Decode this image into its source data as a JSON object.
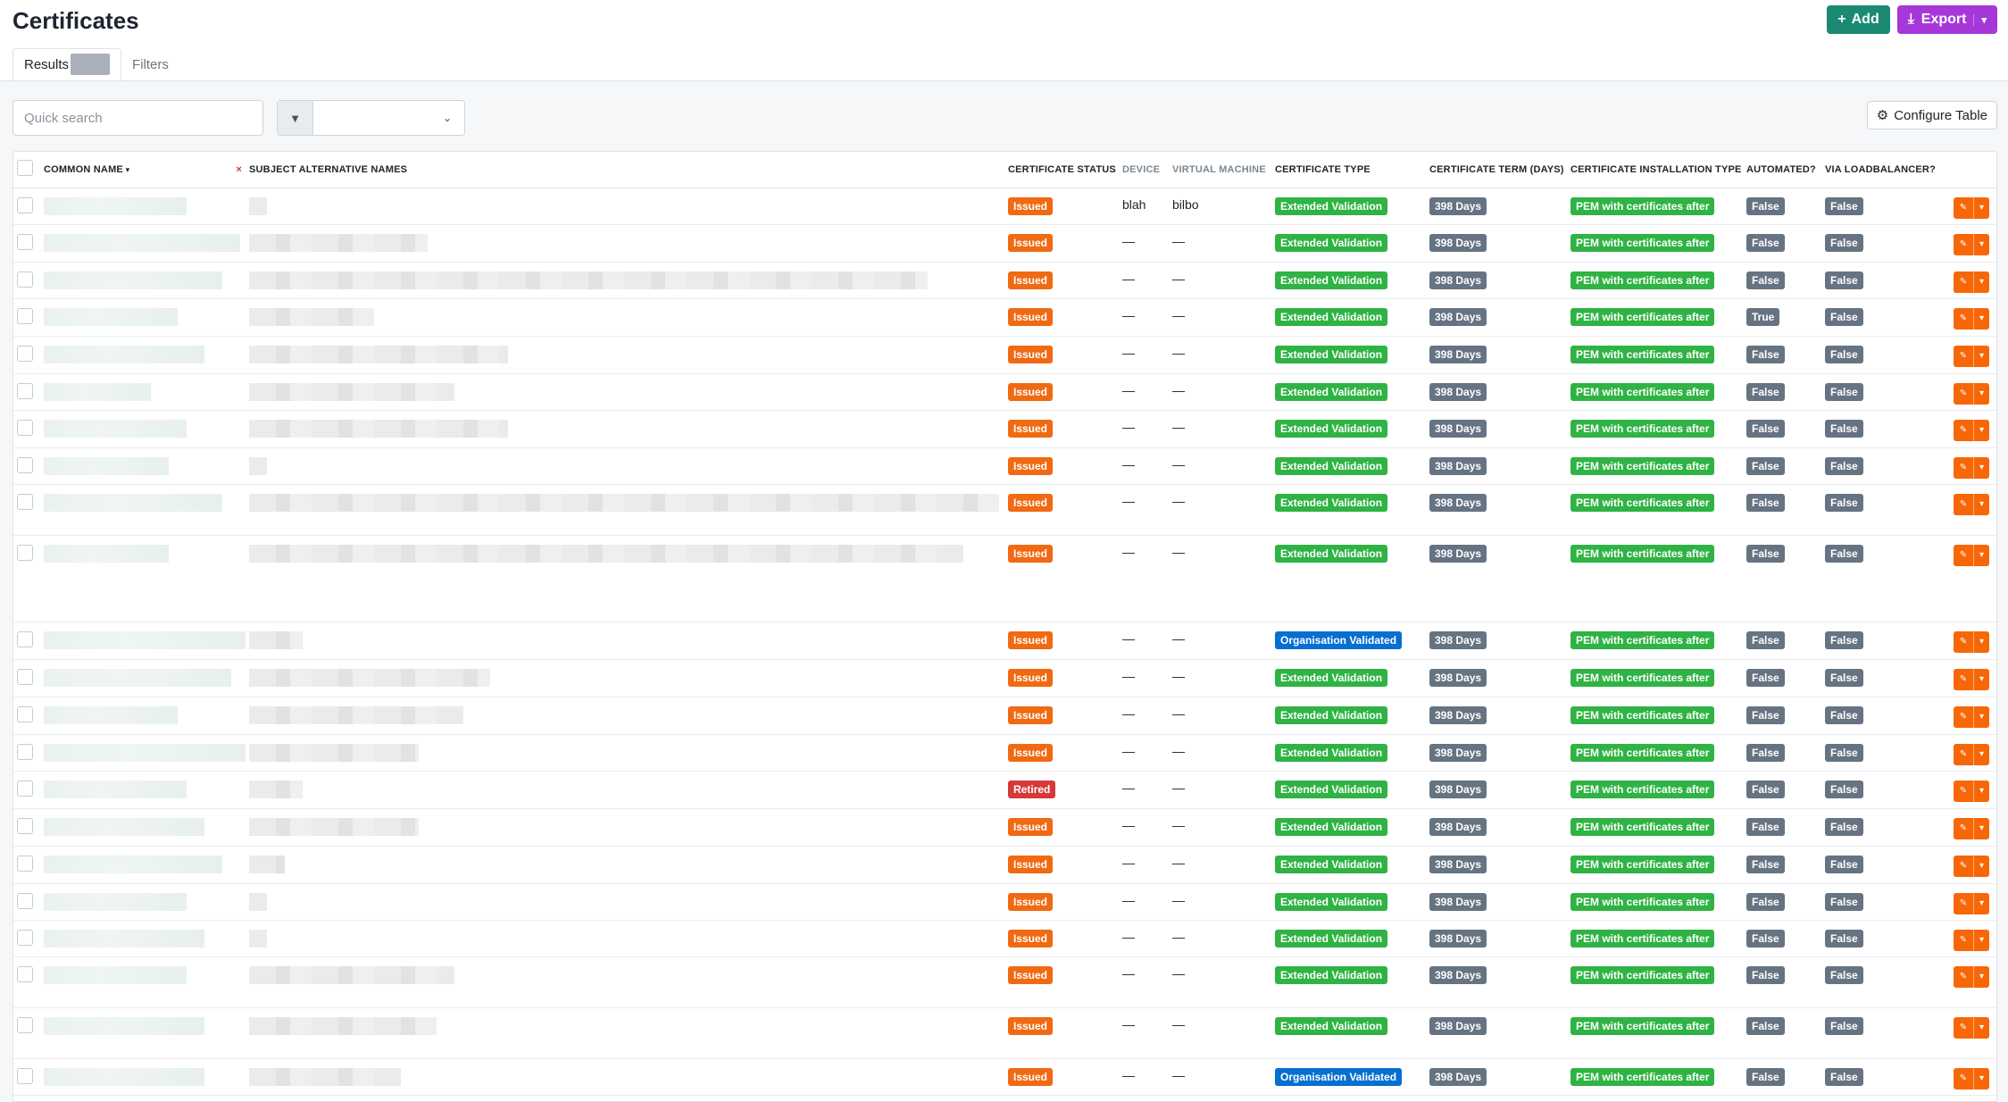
{
  "page": {
    "title": "Certificates"
  },
  "header": {
    "add_label": "Add",
    "export_label": "Export"
  },
  "tabs": [
    {
      "label": "Results"
    },
    {
      "label": "Filters"
    }
  ],
  "toolbar": {
    "search_placeholder": "Quick search",
    "configure_label": "Configure Table"
  },
  "columns": {
    "common_name": "Common Name",
    "san": "Subject Alternative Names",
    "status": "Certificate Status",
    "device": "Device",
    "vm": "Virtual Machine",
    "type": "Certificate Type",
    "term": "Certificate Term (Days)",
    "install": "Certificate Installation Type",
    "automated": "Automated?",
    "lb": "Via Loadbalancer?"
  },
  "colors": {
    "issued": "#f06a13",
    "retired": "#d63939",
    "green": "#2fb344",
    "blue": "#066fd1",
    "grey": "#667382",
    "add": "#1c8a73",
    "export": "#a737d9"
  },
  "rows": [
    {
      "status": "Issued",
      "device": "blah",
      "vm": "bilbo",
      "type": "Extended Validation",
      "term": "398 Days",
      "install": "PEM with certificates after",
      "automated": "False",
      "lb": "False"
    },
    {
      "status": "Issued",
      "device": "—",
      "vm": "—",
      "type": "Extended Validation",
      "term": "398 Days",
      "install": "PEM with certificates after",
      "automated": "False",
      "lb": "False"
    },
    {
      "status": "Issued",
      "device": "—",
      "vm": "—",
      "type": "Extended Validation",
      "term": "398 Days",
      "install": "PEM with certificates after",
      "automated": "False",
      "lb": "False"
    },
    {
      "status": "Issued",
      "device": "—",
      "vm": "—",
      "type": "Extended Validation",
      "term": "398 Days",
      "install": "PEM with certificates after",
      "automated": "True",
      "lb": "False"
    },
    {
      "status": "Issued",
      "device": "—",
      "vm": "—",
      "type": "Extended Validation",
      "term": "398 Days",
      "install": "PEM with certificates after",
      "automated": "False",
      "lb": "False"
    },
    {
      "status": "Issued",
      "device": "—",
      "vm": "—",
      "type": "Extended Validation",
      "term": "398 Days",
      "install": "PEM with certificates after",
      "automated": "False",
      "lb": "False"
    },
    {
      "status": "Issued",
      "device": "—",
      "vm": "—",
      "type": "Extended Validation",
      "term": "398 Days",
      "install": "PEM with certificates after",
      "automated": "False",
      "lb": "False"
    },
    {
      "status": "Issued",
      "device": "—",
      "vm": "—",
      "type": "Extended Validation",
      "term": "398 Days",
      "install": "PEM with certificates after",
      "automated": "False",
      "lb": "False"
    },
    {
      "status": "Issued",
      "device": "—",
      "vm": "—",
      "type": "Extended Validation",
      "term": "398 Days",
      "install": "PEM with certificates after",
      "automated": "False",
      "lb": "False"
    },
    {
      "status": "Issued",
      "device": "—",
      "vm": "—",
      "type": "Extended Validation",
      "term": "398 Days",
      "install": "PEM with certificates after",
      "automated": "False",
      "lb": "False"
    },
    {
      "status": "Issued",
      "device": "—",
      "vm": "—",
      "type": "Organisation Validated",
      "term": "398 Days",
      "install": "PEM with certificates after",
      "automated": "False",
      "lb": "False"
    },
    {
      "status": "Issued",
      "device": "—",
      "vm": "—",
      "type": "Extended Validation",
      "term": "398 Days",
      "install": "PEM with certificates after",
      "automated": "False",
      "lb": "False"
    },
    {
      "status": "Issued",
      "device": "—",
      "vm": "—",
      "type": "Extended Validation",
      "term": "398 Days",
      "install": "PEM with certificates after",
      "automated": "False",
      "lb": "False"
    },
    {
      "status": "Issued",
      "device": "—",
      "vm": "—",
      "type": "Extended Validation",
      "term": "398 Days",
      "install": "PEM with certificates after",
      "automated": "False",
      "lb": "False"
    },
    {
      "status": "Retired",
      "device": "—",
      "vm": "—",
      "type": "Extended Validation",
      "term": "398 Days",
      "install": "PEM with certificates after",
      "automated": "False",
      "lb": "False"
    },
    {
      "status": "Issued",
      "device": "—",
      "vm": "—",
      "type": "Extended Validation",
      "term": "398 Days",
      "install": "PEM with certificates after",
      "automated": "False",
      "lb": "False"
    },
    {
      "status": "Issued",
      "device": "—",
      "vm": "—",
      "type": "Extended Validation",
      "term": "398 Days",
      "install": "PEM with certificates after",
      "automated": "False",
      "lb": "False"
    },
    {
      "status": "Issued",
      "device": "—",
      "vm": "—",
      "type": "Extended Validation",
      "term": "398 Days",
      "install": "PEM with certificates after",
      "automated": "False",
      "lb": "False"
    },
    {
      "status": "Issued",
      "device": "—",
      "vm": "—",
      "type": "Extended Validation",
      "term": "398 Days",
      "install": "PEM with certificates after",
      "automated": "False",
      "lb": "False"
    },
    {
      "status": "Issued",
      "device": "—",
      "vm": "—",
      "type": "Extended Validation",
      "term": "398 Days",
      "install": "PEM with certificates after",
      "automated": "False",
      "lb": "False"
    },
    {
      "status": "Issued",
      "device": "—",
      "vm": "—",
      "type": "Extended Validation",
      "term": "398 Days",
      "install": "PEM with certificates after",
      "automated": "False",
      "lb": "False"
    },
    {
      "status": "Issued",
      "device": "—",
      "vm": "—",
      "type": "Organisation Validated",
      "term": "398 Days",
      "install": "PEM with certificates after",
      "automated": "False",
      "lb": "False"
    }
  ]
}
